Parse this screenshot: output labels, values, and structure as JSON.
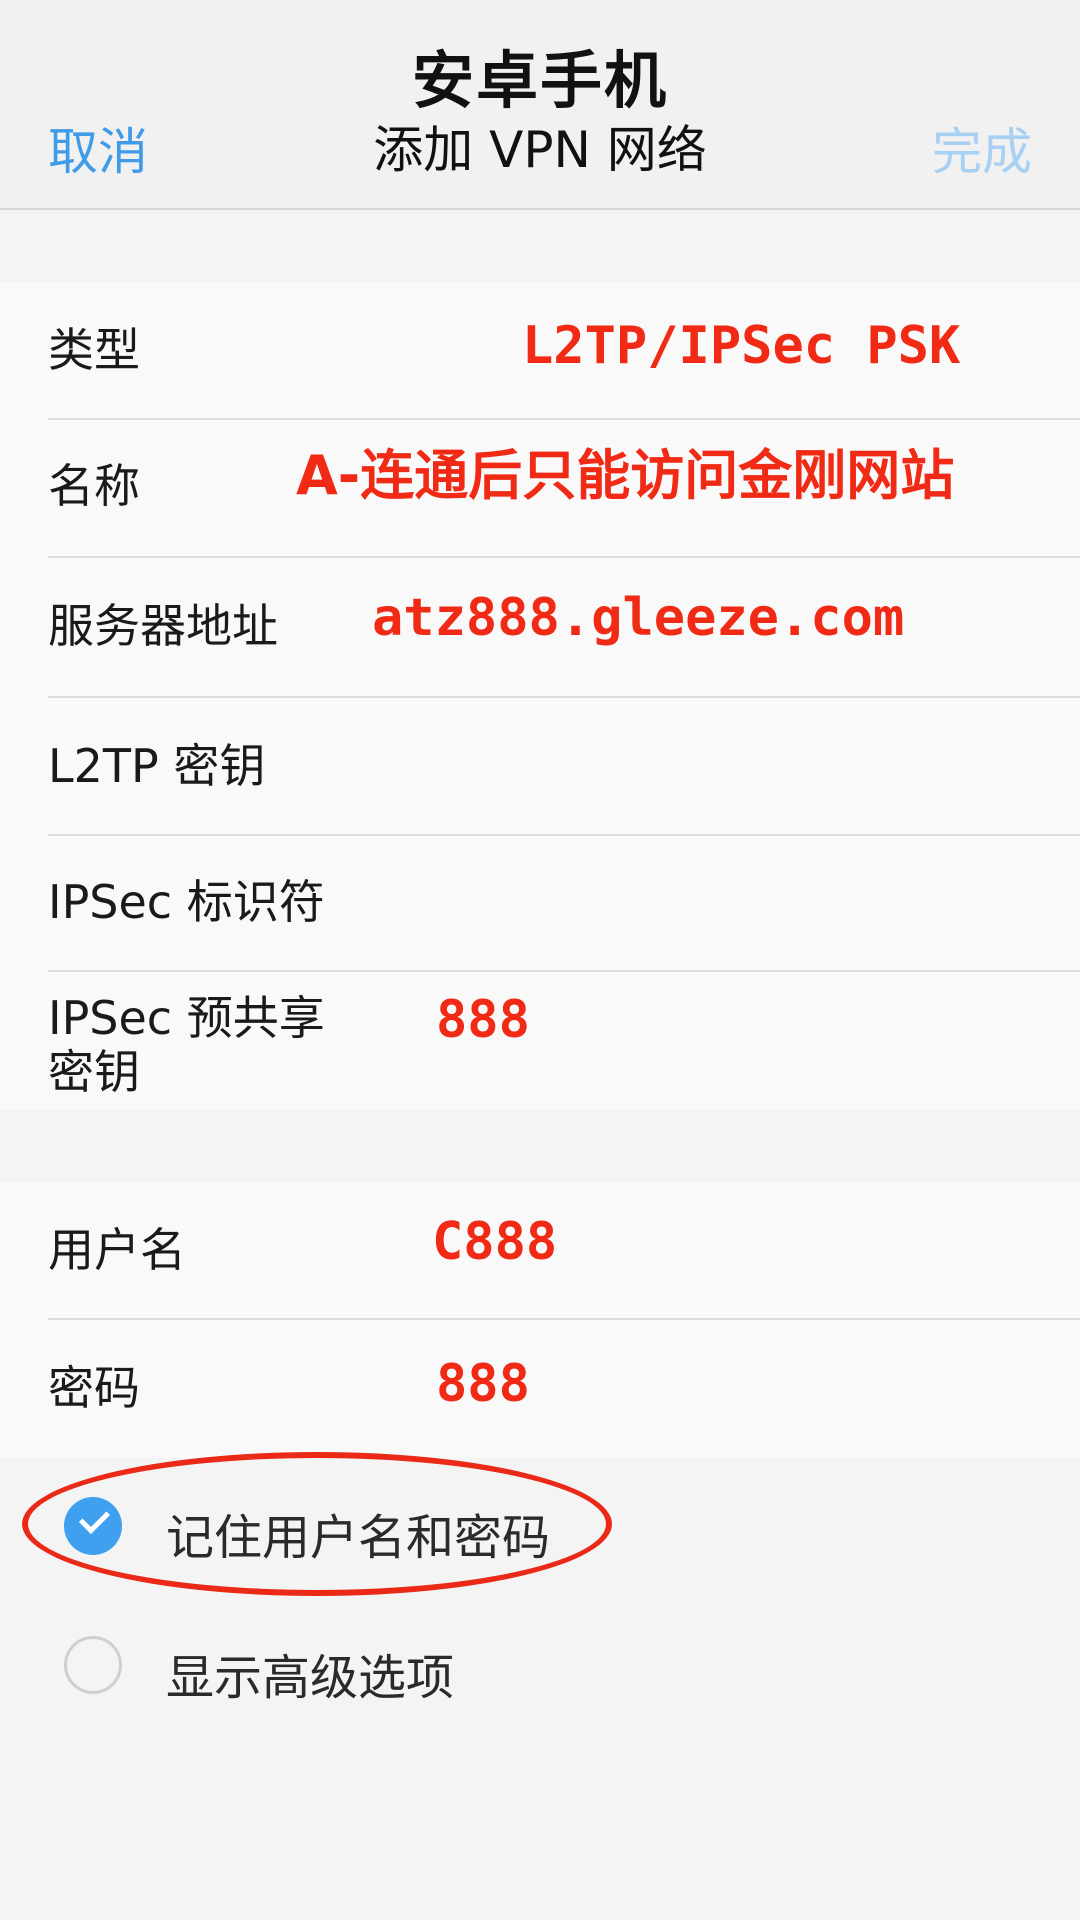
{
  "header": {
    "watermark": "安卓手机",
    "title": "添加 VPN 网络",
    "cancel": "取消",
    "done": "完成"
  },
  "fields_section1": [
    {
      "label": "类型",
      "value": "L2TP/IPSec PSK"
    },
    {
      "label": "名称",
      "value": "A-连通后只能访问金刚网站"
    },
    {
      "label": "服务器地址",
      "value": "atz888.gleeze.com"
    },
    {
      "label": "L2TP 密钥",
      "value": ""
    },
    {
      "label": "IPSec 标识符",
      "value": ""
    },
    {
      "label": "IPSec 预共享\n密钥",
      "label_line1": "IPSec 预共享",
      "label_line2": "密钥",
      "value": "888"
    }
  ],
  "fields_section2": [
    {
      "label": "用户名",
      "value": "C888"
    },
    {
      "label": "密码",
      "value": "888"
    }
  ],
  "options": [
    {
      "label": "记住用户名和密码",
      "checked": true
    },
    {
      "label": "显示高级选项",
      "checked": false
    }
  ],
  "colors": {
    "accent": "#3ea0ee",
    "annotation": "#f02a14"
  }
}
